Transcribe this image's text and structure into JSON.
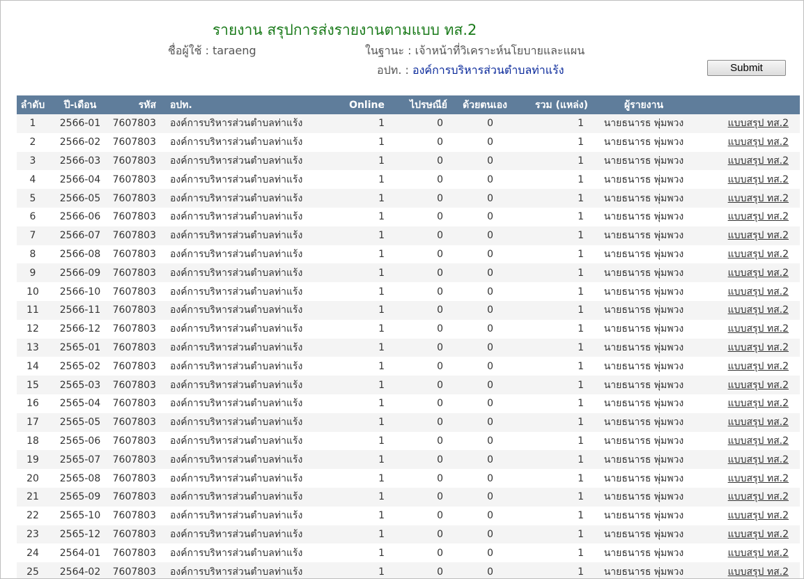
{
  "header": {
    "title": "รายงาน สรุปการส่งรายงานตามแบบ ทส.2",
    "user_label": "ชื่อผู้ใช้ :",
    "user_value": "taraeng",
    "role_label": "ในฐานะ :",
    "role_value": "เจ้าหน้าที่วิเคราะห์นโยบายและแผน",
    "org_label": "อปท. :",
    "org_value": "องค์การบริหารส่วนตำบลท่าแร้ง",
    "submit_label": "Submit"
  },
  "table": {
    "columns": [
      "ลำดับ",
      "ปี-เดือน",
      "รหัส",
      "อปท.",
      "Online",
      "ไปรษณีย์",
      "ด้วยตนเอง",
      "รวม (แหล่ง)",
      "ผู้รายงาน",
      ""
    ],
    "rows": [
      {
        "no": "1",
        "period": "2566-01",
        "code": "7607803",
        "org": "องค์การบริหารส่วนตำบลท่าแร้ง",
        "online": "1",
        "post": "0",
        "self": "0",
        "total": "1",
        "reporter": "นายธนารธ พุ่มพวง",
        "link": "แบบสรุป ทส.2"
      },
      {
        "no": "2",
        "period": "2566-02",
        "code": "7607803",
        "org": "องค์การบริหารส่วนตำบลท่าแร้ง",
        "online": "1",
        "post": "0",
        "self": "0",
        "total": "1",
        "reporter": "นายธนารธ พุ่มพวง",
        "link": "แบบสรุป ทส.2"
      },
      {
        "no": "3",
        "period": "2566-03",
        "code": "7607803",
        "org": "องค์การบริหารส่วนตำบลท่าแร้ง",
        "online": "1",
        "post": "0",
        "self": "0",
        "total": "1",
        "reporter": "นายธนารธ พุ่มพวง",
        "link": "แบบสรุป ทส.2"
      },
      {
        "no": "4",
        "period": "2566-04",
        "code": "7607803",
        "org": "องค์การบริหารส่วนตำบลท่าแร้ง",
        "online": "1",
        "post": "0",
        "self": "0",
        "total": "1",
        "reporter": "นายธนารธ พุ่มพวง",
        "link": "แบบสรุป ทส.2"
      },
      {
        "no": "5",
        "period": "2566-05",
        "code": "7607803",
        "org": "องค์การบริหารส่วนตำบลท่าแร้ง",
        "online": "1",
        "post": "0",
        "self": "0",
        "total": "1",
        "reporter": "นายธนารธ พุ่มพวง",
        "link": "แบบสรุป ทส.2"
      },
      {
        "no": "6",
        "period": "2566-06",
        "code": "7607803",
        "org": "องค์การบริหารส่วนตำบลท่าแร้ง",
        "online": "1",
        "post": "0",
        "self": "0",
        "total": "1",
        "reporter": "นายธนารธ พุ่มพวง",
        "link": "แบบสรุป ทส.2"
      },
      {
        "no": "7",
        "period": "2566-07",
        "code": "7607803",
        "org": "องค์การบริหารส่วนตำบลท่าแร้ง",
        "online": "1",
        "post": "0",
        "self": "0",
        "total": "1",
        "reporter": "นายธนารธ พุ่มพวง",
        "link": "แบบสรุป ทส.2"
      },
      {
        "no": "8",
        "period": "2566-08",
        "code": "7607803",
        "org": "องค์การบริหารส่วนตำบลท่าแร้ง",
        "online": "1",
        "post": "0",
        "self": "0",
        "total": "1",
        "reporter": "นายธนารธ พุ่มพวง",
        "link": "แบบสรุป ทส.2"
      },
      {
        "no": "9",
        "period": "2566-09",
        "code": "7607803",
        "org": "องค์การบริหารส่วนตำบลท่าแร้ง",
        "online": "1",
        "post": "0",
        "self": "0",
        "total": "1",
        "reporter": "นายธนารธ พุ่มพวง",
        "link": "แบบสรุป ทส.2"
      },
      {
        "no": "10",
        "period": "2566-10",
        "code": "7607803",
        "org": "องค์การบริหารส่วนตำบลท่าแร้ง",
        "online": "1",
        "post": "0",
        "self": "0",
        "total": "1",
        "reporter": "นายธนารธ พุ่มพวง",
        "link": "แบบสรุป ทส.2"
      },
      {
        "no": "11",
        "period": "2566-11",
        "code": "7607803",
        "org": "องค์การบริหารส่วนตำบลท่าแร้ง",
        "online": "1",
        "post": "0",
        "self": "0",
        "total": "1",
        "reporter": "นายธนารธ พุ่มพวง",
        "link": "แบบสรุป ทส.2"
      },
      {
        "no": "12",
        "period": "2566-12",
        "code": "7607803",
        "org": "องค์การบริหารส่วนตำบลท่าแร้ง",
        "online": "1",
        "post": "0",
        "self": "0",
        "total": "1",
        "reporter": "นายธนารธ พุ่มพวง",
        "link": "แบบสรุป ทส.2"
      },
      {
        "no": "13",
        "period": "2565-01",
        "code": "7607803",
        "org": "องค์การบริหารส่วนตำบลท่าแร้ง",
        "online": "1",
        "post": "0",
        "self": "0",
        "total": "1",
        "reporter": "นายธนารธ พุ่มพวง",
        "link": "แบบสรุป ทส.2"
      },
      {
        "no": "14",
        "period": "2565-02",
        "code": "7607803",
        "org": "องค์การบริหารส่วนตำบลท่าแร้ง",
        "online": "1",
        "post": "0",
        "self": "0",
        "total": "1",
        "reporter": "นายธนารธ พุ่มพวง",
        "link": "แบบสรุป ทส.2"
      },
      {
        "no": "15",
        "period": "2565-03",
        "code": "7607803",
        "org": "องค์การบริหารส่วนตำบลท่าแร้ง",
        "online": "1",
        "post": "0",
        "self": "0",
        "total": "1",
        "reporter": "นายธนารธ พุ่มพวง",
        "link": "แบบสรุป ทส.2"
      },
      {
        "no": "16",
        "period": "2565-04",
        "code": "7607803",
        "org": "องค์การบริหารส่วนตำบลท่าแร้ง",
        "online": "1",
        "post": "0",
        "self": "0",
        "total": "1",
        "reporter": "นายธนารธ พุ่มพวง",
        "link": "แบบสรุป ทส.2"
      },
      {
        "no": "17",
        "period": "2565-05",
        "code": "7607803",
        "org": "องค์การบริหารส่วนตำบลท่าแร้ง",
        "online": "1",
        "post": "0",
        "self": "0",
        "total": "1",
        "reporter": "นายธนารธ พุ่มพวง",
        "link": "แบบสรุป ทส.2"
      },
      {
        "no": "18",
        "period": "2565-06",
        "code": "7607803",
        "org": "องค์การบริหารส่วนตำบลท่าแร้ง",
        "online": "1",
        "post": "0",
        "self": "0",
        "total": "1",
        "reporter": "นายธนารธ พุ่มพวง",
        "link": "แบบสรุป ทส.2"
      },
      {
        "no": "19",
        "period": "2565-07",
        "code": "7607803",
        "org": "องค์การบริหารส่วนตำบลท่าแร้ง",
        "online": "1",
        "post": "0",
        "self": "0",
        "total": "1",
        "reporter": "นายธนารธ พุ่มพวง",
        "link": "แบบสรุป ทส.2"
      },
      {
        "no": "20",
        "period": "2565-08",
        "code": "7607803",
        "org": "องค์การบริหารส่วนตำบลท่าแร้ง",
        "online": "1",
        "post": "0",
        "self": "0",
        "total": "1",
        "reporter": "นายธนารธ พุ่มพวง",
        "link": "แบบสรุป ทส.2"
      },
      {
        "no": "21",
        "period": "2565-09",
        "code": "7607803",
        "org": "องค์การบริหารส่วนตำบลท่าแร้ง",
        "online": "1",
        "post": "0",
        "self": "0",
        "total": "1",
        "reporter": "นายธนารธ พุ่มพวง",
        "link": "แบบสรุป ทส.2"
      },
      {
        "no": "22",
        "period": "2565-10",
        "code": "7607803",
        "org": "องค์การบริหารส่วนตำบลท่าแร้ง",
        "online": "1",
        "post": "0",
        "self": "0",
        "total": "1",
        "reporter": "นายธนารธ พุ่มพวง",
        "link": "แบบสรุป ทส.2"
      },
      {
        "no": "23",
        "period": "2565-12",
        "code": "7607803",
        "org": "องค์การบริหารส่วนตำบลท่าแร้ง",
        "online": "1",
        "post": "0",
        "self": "0",
        "total": "1",
        "reporter": "นายธนารธ พุ่มพวง",
        "link": "แบบสรุป ทส.2"
      },
      {
        "no": "24",
        "period": "2564-01",
        "code": "7607803",
        "org": "องค์การบริหารส่วนตำบลท่าแร้ง",
        "online": "1",
        "post": "0",
        "self": "0",
        "total": "1",
        "reporter": "นายธนารธ พุ่มพวง",
        "link": "แบบสรุป ทส.2"
      },
      {
        "no": "25",
        "period": "2564-02",
        "code": "7607803",
        "org": "องค์การบริหารส่วนตำบลท่าแร้ง",
        "online": "1",
        "post": "0",
        "self": "0",
        "total": "1",
        "reporter": "นายธนารธ พุ่มพวง",
        "link": "แบบสรุป ทส.2"
      }
    ]
  },
  "colors": {
    "title": "#1a7a1a",
    "header_bg": "#5f7d9b",
    "org_value": "#0b2a9b",
    "row_alt": "#f4f4f4"
  }
}
